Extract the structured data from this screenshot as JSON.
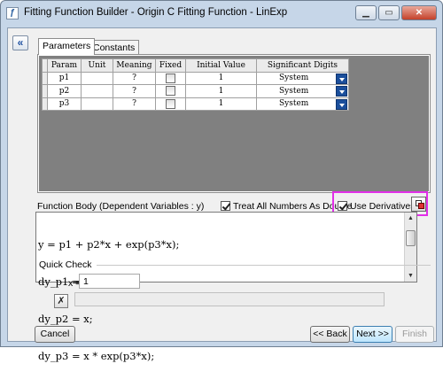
{
  "window": {
    "title": "Fitting Function Builder - Origin C Fitting Function - LinExp",
    "controls": {
      "minimize": "▁",
      "restore": "▭",
      "close": "✕"
    }
  },
  "tabs": [
    {
      "label": "Parameters",
      "active": true
    },
    {
      "label": "Constants",
      "active": false
    }
  ],
  "param_table": {
    "headers": [
      "Param",
      "Unit",
      "Meaning",
      "Fixed",
      "Initial Value",
      "Significant Digits"
    ],
    "rows": [
      {
        "param": "p1",
        "unit": "",
        "meaning": "?",
        "fixed": false,
        "initial": "1",
        "digits": "System"
      },
      {
        "param": "p2",
        "unit": "",
        "meaning": "?",
        "fixed": false,
        "initial": "1",
        "digits": "System"
      },
      {
        "param": "p3",
        "unit": "",
        "meaning": "?",
        "fixed": false,
        "initial": "1",
        "digits": "System"
      }
    ]
  },
  "function_body": {
    "label": "Function Body (Dependent Variables : y)",
    "treat_numbers_label": "Treat All Numbers As Double",
    "treat_numbers_checked": true,
    "use_derivatives_label": "Use Derivatives",
    "use_derivatives_checked": true,
    "code_lines": [
      {
        "pre": "y = p1 + p2*x + exp(p3*x);",
        "num": "",
        "post": ""
      },
      {
        "pre": "dy_p1 = ",
        "num": "1",
        "post": ";"
      },
      {
        "pre": "dy_p2 = x;",
        "num": "",
        "post": ""
      },
      {
        "pre": "dy_p3 = x * exp(p3*x);",
        "num": "",
        "post": ""
      }
    ]
  },
  "quick_check": {
    "label": "Quick Check",
    "x_label": "x =",
    "x_value": "1",
    "result": ""
  },
  "buttons": {
    "collapse": "«",
    "cancel": "Cancel",
    "back": "<< Back",
    "next": "Next >>",
    "finish": "Finish"
  },
  "colors": {
    "highlight": "#e22fe8",
    "dropdown": "#1b4f9c",
    "number_literal": "#1515ff"
  }
}
